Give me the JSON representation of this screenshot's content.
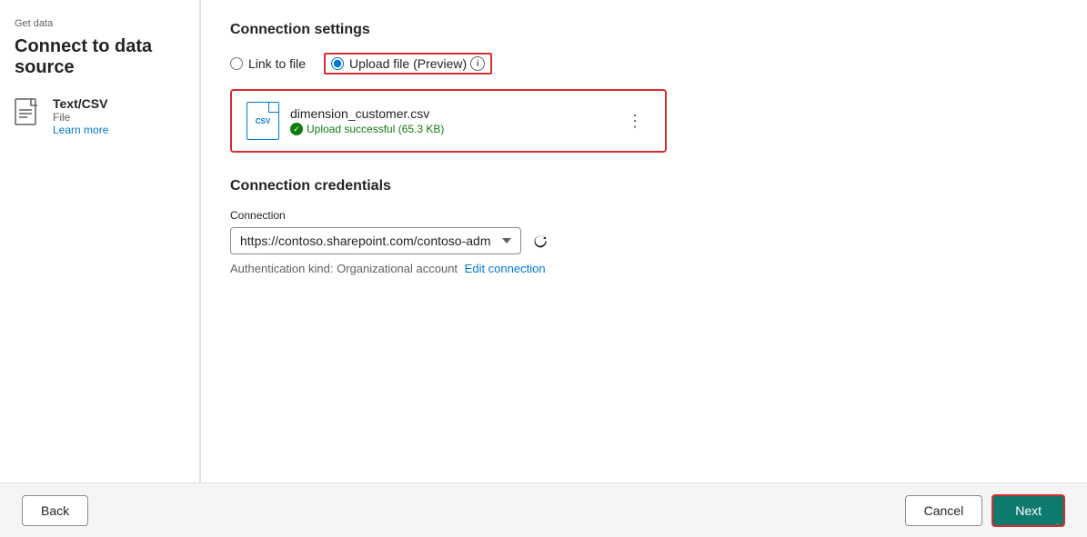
{
  "page": {
    "breadcrumb": "Get data",
    "title": "Connect to data source"
  },
  "sidebar": {
    "item": {
      "icon_label": "Text/CSV file icon",
      "name": "Text/CSV",
      "type": "File",
      "learn_more": "Learn more"
    }
  },
  "connection_settings": {
    "section_title": "Connection settings",
    "radio_link": "Link to file",
    "radio_upload": "Upload file (Preview)",
    "info_icon_label": "i",
    "file": {
      "name": "dimension_customer.csv",
      "status": "Upload successful (65.3 KB)"
    },
    "more_options_label": "⋮"
  },
  "credentials": {
    "section_title": "Connection credentials",
    "connection_label": "Connection",
    "connection_value": "https://contoso.sharepoint.com/contoso-admin",
    "auth_text": "Authentication kind: Organizational account",
    "edit_link": "Edit connection"
  },
  "footer": {
    "back_label": "Back",
    "cancel_label": "Cancel",
    "next_label": "Next"
  }
}
